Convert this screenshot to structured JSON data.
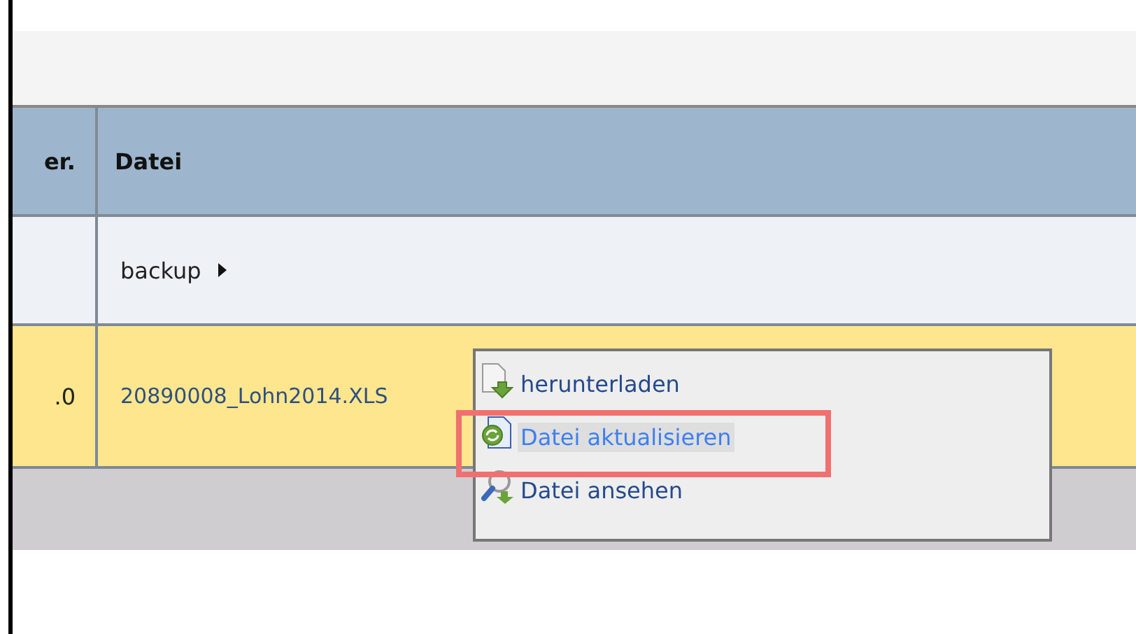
{
  "table": {
    "columns": [
      "er.",
      "Datei"
    ],
    "rows": [
      {
        "kind": "folder",
        "cells": [
          "",
          "backup"
        ]
      },
      {
        "kind": "file",
        "cells": [
          ".0",
          "20890008_Lohn2014.XLS"
        ]
      },
      {
        "kind": "empty",
        "cells": [
          "",
          ""
        ]
      }
    ]
  },
  "context_menu": {
    "items": [
      {
        "label": "herunterladen",
        "kind": "download",
        "selected": false,
        "highlighted": false
      },
      {
        "label": "Datei aktualisieren",
        "kind": "update",
        "selected": true,
        "highlighted": true
      },
      {
        "label": "Datei ansehen",
        "kind": "view",
        "selected": false,
        "highlighted": false
      }
    ]
  }
}
